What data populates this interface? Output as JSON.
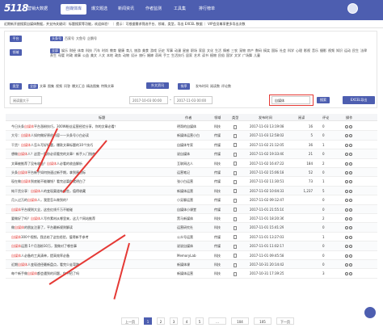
{
  "app": {
    "logo": "5118",
    "brand": "营销大数据"
  },
  "nav": [
    {
      "label": "自媒体库",
      "active": true
    },
    {
      "label": "爆文题选"
    },
    {
      "label": "新闻资讯"
    },
    {
      "label": "作者监测"
    },
    {
      "label": "工具集"
    },
    {
      "label": "排行榜单"
    }
  ],
  "notice": "近期新开放搜索自媒体数据，并支持关键词：标题搜索等功能，欢迎体验！ ｜ 提示：可根据需求筛选平台、领域、类型，导出 EXCEL 数据 ｜ VIP会员尊享更多导出次数",
  "filters": {
    "platform_label": "平台",
    "platforms": [
      "头条号",
      "百家号",
      "大鱼号",
      "企鹅号"
    ],
    "domain_label": "领域",
    "domains": [
      "全部",
      "娱乐",
      "财经",
      "体育",
      "科技",
      "汽车",
      "时尚",
      "教育",
      "健康",
      "育儿",
      "旅游",
      "美食",
      "游戏",
      "历史",
      "军事",
      "动漫",
      "星座",
      "职场",
      "家居",
      "文化",
      "生活",
      "情感",
      "三农",
      "宠物",
      "房产",
      "数码",
      "搞笑",
      "国际",
      "社会",
      "科学",
      "心理",
      "影视",
      "音乐",
      "摄影",
      "视频",
      "知识",
      "运动",
      "民生",
      "法律",
      "养生",
      "母婴",
      "时政",
      "故事",
      "公益",
      "美文",
      "人文",
      "本地",
      "政务",
      "动物",
      "设计",
      "旅行",
      "婚嫁",
      "奇闻",
      "手工",
      "生活技巧",
      "居家",
      "艺术",
      "读书",
      "植物",
      "民俗",
      "国学",
      "文学",
      "广场舞",
      "儿童"
    ],
    "type_label": "类型",
    "types": [
      "全部",
      "文章",
      "图集",
      "视频",
      "问答",
      "爆文汇总",
      "精选图集",
      "特殊文章"
    ],
    "type_extra": "外文资讯",
    "sort_label": "排序",
    "sorts": [
      "发布时间",
      "阅读数",
      "评论数"
    ],
    "date_from": "2017-10-03 00:00",
    "date_to": "2017-11-03 00:00",
    "read_placeholder": "阅读量大于",
    "search_value": "自媒体",
    "search_button": "搜索",
    "export_button": "EXCEL导出"
  },
  "table": {
    "headers": [
      "标题",
      "作者",
      "领域",
      "类型",
      "发布时间",
      "阅读",
      "评论",
      "操作"
    ],
    "rows": [
      {
        "pre": "今日头条",
        "kw": "自媒体",
        "post": "平台涨粉技巧，300W粉丝运营经验分享，你的文章必看！",
        "author": "明哥的自媒体",
        "cat": "科技",
        "time": "2017-11-03 13:19:08",
        "read": "16",
        "cmt": "0"
      },
      {
        "pre": "大号：",
        "kw": "自媒体",
        "post": "人如何做好原创内容——头条号小白必读",
        "author": "新媒体运营小白",
        "cat": "传媒",
        "time": "2017-11-03 12:58:02",
        "read": "5",
        "cmt": "0"
      },
      {
        "pre": "干货！",
        "kw": "自媒体",
        "post": "人怎么写好标题，爆款文章标题的10个技巧",
        "author": "自媒体专家",
        "cat": "传媒",
        "time": "2017-11-02 21:12:05",
        "read": "36",
        "cmt": "1"
      },
      {
        "pre": "想做",
        "kw": "自媒体",
        "post": "人？这是一篇你必须看完的文章！新手入门指南",
        "author": "说自媒体",
        "cat": "传媒",
        "time": "2017-11-02 19:33:40",
        "read": "21",
        "cmt": "0"
      },
      {
        "pre": "文章被推荐了没有收益？",
        "kw": "自媒体",
        "post": "人必看的收益解析",
        "author": "互联网达人",
        "cat": "科技",
        "time": "2017-11-02 16:47:22",
        "read": "184",
        "cmt": "2"
      },
      {
        "pre": "头条",
        "kw": "自媒体",
        "post": "平台新手如何快速过新手期，拿到原创标",
        "author": "运营笔记",
        "cat": "传媒",
        "time": "2017-11-02 15:06:18",
        "read": "52",
        "cmt": "0"
      },
      {
        "pre": "现在做",
        "kw": "自媒体",
        "post": "到底能不能赚钱？看完这篇你就明白了",
        "author": "张小白运营",
        "cat": "传媒",
        "time": "2017-11-02 11:30:51",
        "read": "73",
        "cmt": "1"
      },
      {
        "pre": "纯干货分享：",
        "kw": "自媒体",
        "post": "人的变现渠道有哪些，值得收藏",
        "author": "新媒体运营",
        "cat": "科技",
        "time": "2017-11-02 10:04:33",
        "read": "1,237",
        "cmt": "5"
      },
      {
        "pre": "月入过万的",
        "kw": "自媒体",
        "post": "人，我是怎么做到的？",
        "author": "小吴聊运营",
        "cat": "传媒",
        "time": "2017-11-02 09:12:47",
        "read": "",
        "cmt": "0"
      },
      {
        "pre": "",
        "kw": "自媒体",
        "post": "平台规则大全，这些红线千万不能碰",
        "author": "自媒体小课堂",
        "cat": "传媒",
        "time": "2017-11-01 21:55:10",
        "read": "",
        "cmt": "0"
      },
      {
        "pre": "要做好了吗？",
        "kw": "自媒体",
        "post": "人写作素材从哪里来，这几个网站推荐",
        "author": "黑马新媒体",
        "cat": "科技",
        "time": "2017-11-01 18:20:36",
        "read": "",
        "cmt": "2"
      },
      {
        "pre": "做",
        "kw": "自媒体",
        "post": "的朋友注意了，平台最新规则解读",
        "author": "运营研究社",
        "cat": "科技",
        "time": "2017-11-01 15:41:29",
        "read": "",
        "cmt": "0"
      },
      {
        "pre": "",
        "kw": "自媒体",
        "post": "300个视频，我总结了这些经验，值得新手参考",
        "author": "公众号运营",
        "cat": "传媒",
        "time": "2017-11-01 13:27:03",
        "read": "",
        "cmt": "1"
      },
      {
        "pre": "",
        "kw": "自媒体",
        "post": "运营:1个月涨粉10万，我做对了哪些事",
        "author": "说说自媒体",
        "cat": "传媒",
        "time": "2017-11-01 11:02:17",
        "read": "",
        "cmt": "0"
      },
      {
        "pre": "",
        "kw": "自媒体",
        "post": "人必备的工具清单，提高效率必备",
        "author": "MemoryLab",
        "cat": "科技",
        "time": "2017-11-01 09:45:58",
        "read": "",
        "cmt": "0"
      },
      {
        "pre": "近期",
        "kw": "自媒体",
        "post": "人变现途径最新盘点，看完少走弯路",
        "author": "新媒体课",
        "cat": "科技",
        "time": "2017-10-31 20:14:42",
        "read": "",
        "cmt": "0"
      },
      {
        "pre": "每个新手做",
        "kw": "自媒体",
        "post": "都会遇到的问题，你中招了吗",
        "author": "新媒体运营",
        "cat": "科技",
        "time": "2017-10-31 17:39:25",
        "read": "",
        "cmt": "3"
      }
    ]
  },
  "pager": {
    "items": [
      "上一页",
      "1",
      "2",
      "3",
      "4",
      "5",
      "...",
      "104",
      "105",
      "下一页"
    ],
    "current": "1"
  },
  "colors": {
    "brand": "#4d5eb0",
    "keyword": "#e53935",
    "arrow": "#e53935"
  }
}
